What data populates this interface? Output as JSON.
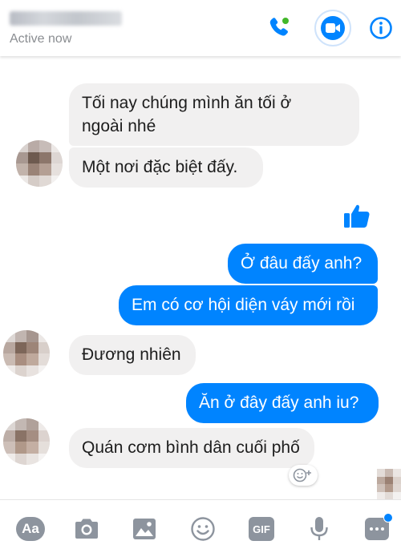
{
  "header": {
    "contact_name": "",
    "status": "Active now",
    "icons": [
      "phone-icon",
      "video-camera-icon",
      "info-icon"
    ]
  },
  "messages": [
    {
      "direction": "incoming",
      "lines": [
        "Tối nay chúng mình ăn tối ở",
        "ngoài nhé"
      ]
    },
    {
      "direction": "incoming",
      "text": "Một nơi đặc biệt đấy."
    },
    {
      "direction": "outgoing",
      "type": "like-sticker",
      "icon": "thumbs-up-icon"
    },
    {
      "direction": "outgoing",
      "text": "Ở đâu đấy anh?"
    },
    {
      "direction": "outgoing",
      "text": "Em có cơ hội diện váy mới rồi"
    },
    {
      "direction": "incoming",
      "text": "Đương nhiên"
    },
    {
      "direction": "outgoing",
      "text": "Ăn ở đây đấy anh iu?"
    },
    {
      "direction": "incoming",
      "text": "Quán cơm bình dân cuối phố"
    }
  ],
  "toolbar": {
    "aa_label": "Aa",
    "gif_label": "GIF",
    "icons": [
      "text-format-icon",
      "camera-icon",
      "gallery-icon",
      "emoji-icon",
      "gif-icon",
      "microphone-icon",
      "more-icon"
    ]
  },
  "colors": {
    "accent": "#0084ff",
    "incoming_bubble": "#f1f0f0",
    "toolbar_icon": "#8d949e"
  }
}
